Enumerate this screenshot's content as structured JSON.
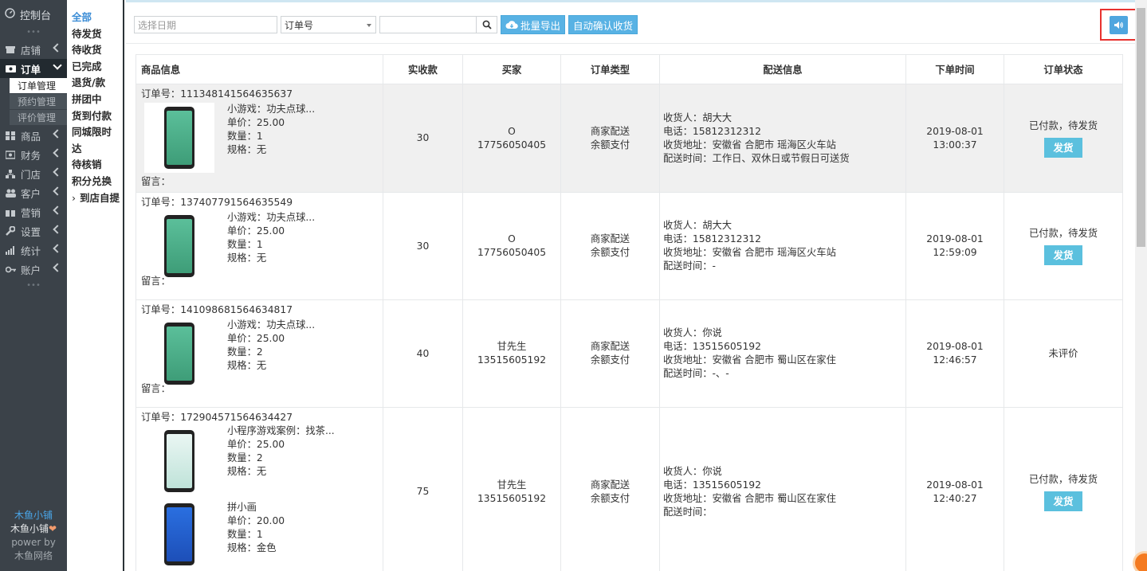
{
  "sidebar": {
    "top_label": "控制台",
    "items": [
      {
        "label": "店铺",
        "icon": "shop-icon"
      },
      {
        "label": "订单",
        "icon": "order-icon",
        "active": true
      },
      {
        "label": "商品",
        "icon": "goods-icon"
      },
      {
        "label": "财务",
        "icon": "finance-icon"
      },
      {
        "label": "门店",
        "icon": "store-icon"
      },
      {
        "label": "客户",
        "icon": "customer-icon"
      },
      {
        "label": "营销",
        "icon": "marketing-icon"
      },
      {
        "label": "设置",
        "icon": "settings-icon"
      },
      {
        "label": "统计",
        "icon": "stats-icon"
      },
      {
        "label": "账户",
        "icon": "account-icon"
      }
    ],
    "subitems": [
      "订单管理",
      "预约管理",
      "评价管理"
    ],
    "footer": {
      "line1": "木鱼小铺",
      "line2": "木鱼小铺",
      "line3": "power by",
      "line4": "木鱼网络"
    }
  },
  "subnav": {
    "items": [
      "全部",
      "待发货",
      "待收货",
      "已完成",
      "退货/款",
      "拼团中",
      "货到付款",
      "同城限时达",
      "待核销",
      "积分兑换",
      "到店自提"
    ]
  },
  "toolbar": {
    "date_placeholder": "选择日期",
    "select_value": "订单号",
    "search_value": "",
    "export_label": "批量导出",
    "confirm_label": "自动确认收货"
  },
  "table": {
    "headers": [
      "商品信息",
      "实收款",
      "买家",
      "订单类型",
      "配送信息",
      "下单时间",
      "订单状态"
    ],
    "rows": [
      {
        "order_no": "订单号：111348141564635637",
        "products": [
          {
            "name": "小游戏：功夫点球...",
            "price": "单价：25.00",
            "qty": "数量：1",
            "spec": "规格：无"
          }
        ],
        "message": "留言：",
        "amount": "30",
        "buyer_name": "O",
        "buyer_phone": "17756050405",
        "type1": "商家配送",
        "type2": "余额支付",
        "ship": [
          "收货人：胡大大",
          "电话：15812312312",
          "收货地址：安徽省 合肥市 瑶海区火车站",
          "配送时间：工作日、双休日或节假日可送货"
        ],
        "date": "2019-08-01",
        "time": "13:00:37",
        "status": "已付款，待发货",
        "action": "发货"
      },
      {
        "order_no": "订单号：137407791564635549",
        "products": [
          {
            "name": "小游戏：功夫点球...",
            "price": "单价：25.00",
            "qty": "数量：1",
            "spec": "规格：无"
          }
        ],
        "message": "留言：",
        "amount": "30",
        "buyer_name": "O",
        "buyer_phone": "17756050405",
        "type1": "商家配送",
        "type2": "余额支付",
        "ship": [
          "收货人：胡大大",
          "电话：15812312312",
          "收货地址：安徽省 合肥市 瑶海区火车站",
          "配送时间：-"
        ],
        "date": "2019-08-01",
        "time": "12:59:09",
        "status": "已付款，待发货",
        "action": "发货"
      },
      {
        "order_no": "订单号：141098681564634817",
        "products": [
          {
            "name": "小游戏：功夫点球...",
            "price": "单价：25.00",
            "qty": "数量：2",
            "spec": "规格：无"
          }
        ],
        "message": "留言：",
        "amount": "40",
        "buyer_name": "甘先生",
        "buyer_phone": "13515605192",
        "type1": "商家配送",
        "type2": "余额支付",
        "ship": [
          "收货人：你说",
          "电话：13515605192",
          "收货地址：安徽省 合肥市 蜀山区在家住",
          "配送时间：-、-"
        ],
        "date": "2019-08-01",
        "time": "12:46:57",
        "status": "未评价",
        "action": ""
      },
      {
        "order_no": "订单号：172904571564634427",
        "products": [
          {
            "name": "小程序游戏案例：找茶...",
            "price": "单价：25.00",
            "qty": "数量：2",
            "spec": "规格：无"
          },
          {
            "name": "拼小画",
            "price": "单价：20.00",
            "qty": "数量：1",
            "spec": "规格：金色"
          }
        ],
        "message": "",
        "amount": "75",
        "buyer_name": "甘先生",
        "buyer_phone": "13515605192",
        "type1": "商家配送",
        "type2": "余额支付",
        "ship": [
          "收货人：你说",
          "电话：13515605192",
          "收货地址：安徽省 合肥市 蜀山区在家住",
          "配送时间："
        ],
        "date": "2019-08-01",
        "time": "12:40:27",
        "status": "已付款，待发货",
        "action": "发货"
      }
    ]
  },
  "colors": {
    "sidebar_bg": "#3b4249",
    "accent_blue": "#58b2e4",
    "ship_button": "#5bc0de",
    "highlight_border": "#e8322f"
  }
}
